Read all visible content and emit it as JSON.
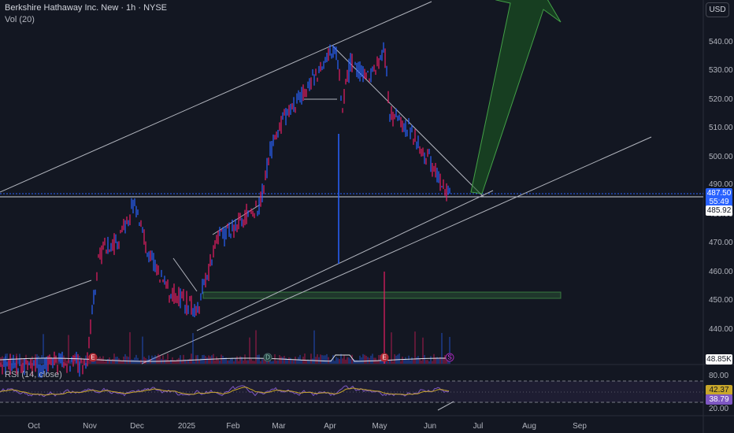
{
  "header": {
    "title": "Berkshire Hathaway Inc. New · 1h · NYSE",
    "volume_label": "Vol (20)",
    "currency_button": "USD"
  },
  "rsi": {
    "label": "RSI (14, close)",
    "value_yellow": "42.37",
    "value_purple": "38.79",
    "levels": [
      "80.00",
      "20.00"
    ]
  },
  "price_axis": {
    "ticks": [
      "540.00",
      "530.00",
      "520.00",
      "510.00",
      "500.00",
      "490.00",
      "480.00",
      "470.00",
      "460.00",
      "450.00",
      "440.00"
    ],
    "last_price": "487.50",
    "countdown": "55:49",
    "line_price": "485.92",
    "volume_value": "48.85K"
  },
  "time_axis": {
    "labels": [
      "Oct",
      "Nov",
      "Dec",
      "2025",
      "Feb",
      "Mar",
      "Apr",
      "May",
      "Jun",
      "Jul",
      "Aug",
      "Sep"
    ]
  },
  "markers": {
    "earnings": "E",
    "dividend": "D",
    "split": "S"
  },
  "colors": {
    "background": "#131722",
    "up": "#2962ff",
    "down": "#e91e63",
    "channel": "#b2b5be",
    "rsi_line": "#7e57c2",
    "rsi_ma": "#c8a62a",
    "zone": "#4caf50",
    "arrow": "#2e7d32"
  }
}
